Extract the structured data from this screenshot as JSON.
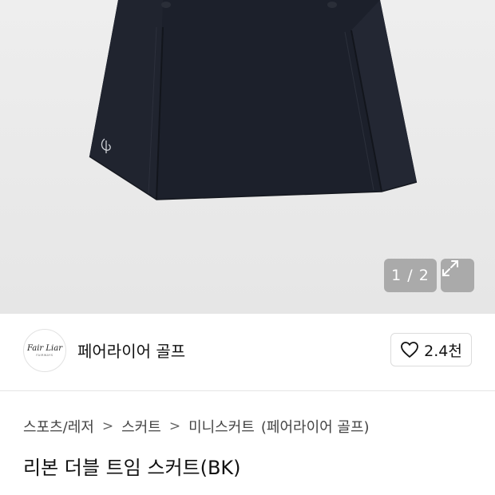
{
  "gallery": {
    "counter_text": "1 / 2",
    "current": 1,
    "total": 2,
    "product_image": "navy-mini-skirt-photo"
  },
  "brand": {
    "logo_text": "Fair Liar",
    "logo_subtext": "FAIRWAYS",
    "name": "페어라이어 골프"
  },
  "like": {
    "icon": "heart-outline-icon",
    "count": "2.4천"
  },
  "breadcrumb": {
    "items": [
      "스포츠/레저",
      "스커트",
      "미니스커트",
      "(페어라이어 골프)"
    ],
    "separator": ">"
  },
  "product": {
    "title": "리본 더블 트임 스커트(BK)"
  },
  "colors": {
    "image_bg": "#e9e9e9",
    "skirt": "#1c202b",
    "badge_bg": "#969696"
  }
}
